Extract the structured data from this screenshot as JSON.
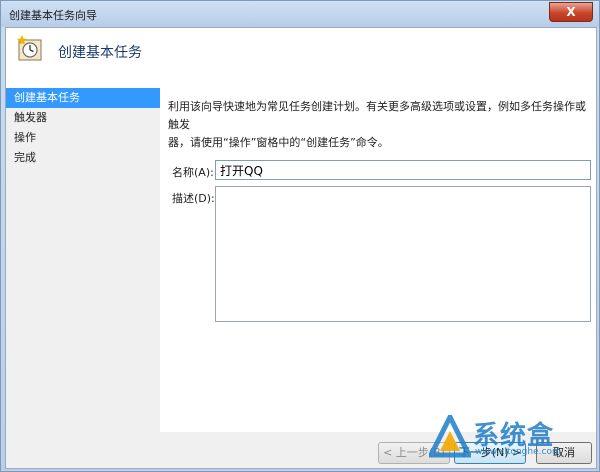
{
  "window": {
    "title": "创建基本任务向导",
    "close_label": "X"
  },
  "header": {
    "title": "创建基本任务"
  },
  "sidebar": {
    "items": [
      {
        "label": "创建基本任务",
        "active": true
      },
      {
        "label": "触发器",
        "active": false
      },
      {
        "label": "操作",
        "active": false
      },
      {
        "label": "完成",
        "active": false
      }
    ]
  },
  "main": {
    "intro_line1": "利用该向导快速地为常见任务创建计划。有关更多高级选项或设置，例如多任务操作或触发",
    "intro_line2": "器，请使用“操作”窗格中的“创建任务”命令。",
    "name_label": "名称(A):",
    "name_value": "打开QQ",
    "desc_label": "描述(D):",
    "desc_value": ""
  },
  "footer": {
    "back_label": "< 上一步(B)",
    "next_label": "下一步(N) >",
    "cancel_label": "取消"
  },
  "watermark": {
    "text": "系统盒",
    "url": "www.xitonghe.com"
  }
}
